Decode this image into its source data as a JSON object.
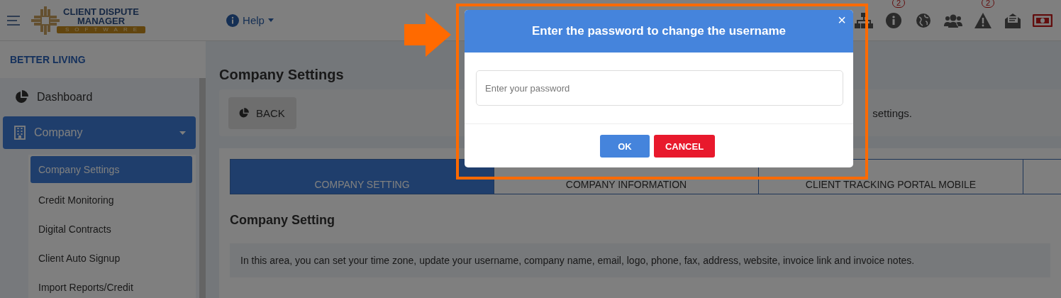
{
  "header": {
    "logo": {
      "line1": "CLIENT DISPUTE",
      "line2": "MANAGER",
      "line3": "SOFTWARE"
    },
    "help": "Help",
    "icons": [
      {
        "kind": "sitemap"
      },
      {
        "kind": "info",
        "badge": "2"
      },
      {
        "kind": "globe"
      },
      {
        "kind": "users"
      },
      {
        "kind": "warning",
        "badge": "2"
      },
      {
        "kind": "envelope"
      },
      {
        "kind": "money"
      }
    ]
  },
  "sidebar": {
    "company": "BETTER LIVING",
    "items": [
      {
        "label": "Dashboard",
        "kind": "chart",
        "selected": false
      },
      {
        "label": "Company",
        "kind": "building",
        "selected": true,
        "children": [
          {
            "label": "Company Settings",
            "selected": true
          },
          {
            "label": "Credit Monitoring",
            "selected": false
          },
          {
            "label": "Digital Contracts",
            "selected": false
          },
          {
            "label": "Client Auto Signup",
            "selected": false
          },
          {
            "label": "Import Reports/Credit",
            "selected": false
          }
        ]
      }
    ]
  },
  "main": {
    "title": "Company Settings",
    "back_button": "BACK",
    "back_note": "settings.",
    "tabs": [
      {
        "label": "COMPANY SETTING",
        "selected": true
      },
      {
        "label": "COMPANY INFORMATION",
        "selected": false
      },
      {
        "label": "CLIENT TRACKING PORTAL MOBILE",
        "selected": false
      },
      {
        "selected": false
      }
    ],
    "section_title": "Company Setting",
    "info": "In this area, you can set your time zone, update your username, company name, email, logo, phone, fax, address, website, invoice link and invoice notes."
  },
  "modal": {
    "title": "Enter the password to change the username",
    "close": "×",
    "placeholder": "Enter your password",
    "ok": "OK",
    "cancel": "CANCEL"
  }
}
